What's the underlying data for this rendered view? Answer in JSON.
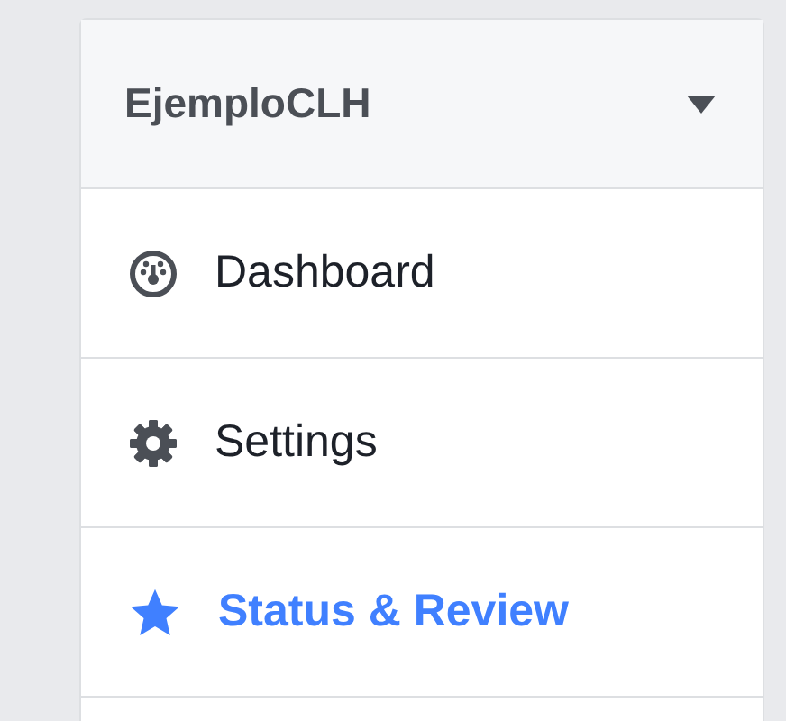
{
  "header": {
    "title": "EjemploCLH"
  },
  "items": [
    {
      "label": "Dashboard",
      "kind": "gauge",
      "selected": false
    },
    {
      "label": "Settings",
      "kind": "gear",
      "selected": false
    },
    {
      "label": "Status & Review",
      "kind": "star",
      "selected": true
    }
  ]
}
